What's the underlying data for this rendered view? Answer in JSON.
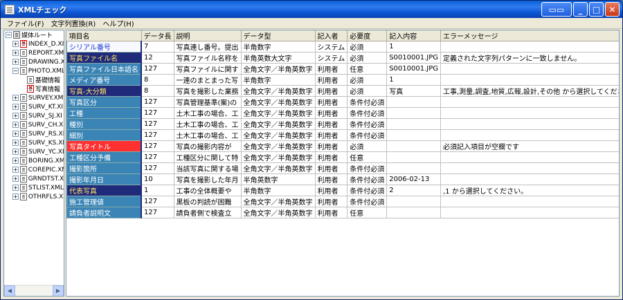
{
  "window": {
    "title": "XMLチェック"
  },
  "menu": [
    "ファイル(F)",
    "文字列置換(R)",
    "ヘルプ(H)"
  ],
  "tree": [
    {
      "label": "媒体ルート",
      "level": 0,
      "expander": "−",
      "icon": "root"
    },
    {
      "label": "INDEX_D.XI",
      "level": 1,
      "expander": "+",
      "icon": "error"
    },
    {
      "label": "REPORT.XM",
      "level": 1,
      "expander": "+",
      "icon": "doc"
    },
    {
      "label": "DRAWING.X",
      "level": 1,
      "expander": "+",
      "icon": "doc"
    },
    {
      "label": "PHOTO.XML",
      "level": 1,
      "expander": "−",
      "icon": "doc"
    },
    {
      "label": "基礎情報",
      "level": 2,
      "expander": "",
      "icon": "doc"
    },
    {
      "label": "写真情報",
      "level": 2,
      "expander": "",
      "icon": "error"
    },
    {
      "label": "SURVEY.XM",
      "level": 1,
      "expander": "+",
      "icon": "doc"
    },
    {
      "label": "SURV_KT.XI",
      "level": 1,
      "expander": "+",
      "icon": "doc"
    },
    {
      "label": "SURV_SJ.XI",
      "level": 1,
      "expander": "+",
      "icon": "doc"
    },
    {
      "label": "SURV_CH.XI",
      "level": 1,
      "expander": "+",
      "icon": "doc"
    },
    {
      "label": "SURV_RS.XI",
      "level": 1,
      "expander": "+",
      "icon": "doc"
    },
    {
      "label": "SURV_KS.XI",
      "level": 1,
      "expander": "+",
      "icon": "doc"
    },
    {
      "label": "SURV_YC.XI",
      "level": 1,
      "expander": "+",
      "icon": "doc"
    },
    {
      "label": "BORING.XM",
      "level": 1,
      "expander": "+",
      "icon": "doc"
    },
    {
      "label": "COREPIC.XM",
      "level": 1,
      "expander": "+",
      "icon": "doc"
    },
    {
      "label": "GRNDTST.XI",
      "level": 1,
      "expander": "+",
      "icon": "doc"
    },
    {
      "label": "STLIST.XML",
      "level": 1,
      "expander": "+",
      "icon": "doc"
    },
    {
      "label": "OTHRFLS.XI",
      "level": 1,
      "expander": "+",
      "icon": "doc"
    }
  ],
  "grid": {
    "headers": [
      "項目名",
      "データ長",
      "説明",
      "データ型",
      "記入者",
      "必要度",
      "記入内容",
      "エラーメッセージ"
    ],
    "rows": [
      {
        "style": "light",
        "cells": [
          "シリアル番号",
          "7",
          "写真連し番号。提出",
          "半角数字",
          "システム",
          "必須",
          "1",
          ""
        ]
      },
      {
        "style": "sel",
        "cells": [
          "写真ファイル名",
          "12",
          "写真ファイル名称を",
          "半角英数大文字",
          "システム",
          "必須",
          "S0010001.JPG",
          "定義された文字列パターンに一致しません。"
        ]
      },
      {
        "style": "normal",
        "cells": [
          "写真ファイル日本語名",
          "127",
          "写真ファイルに関す",
          "全角文字／半角英数字",
          "利用者",
          "任意",
          "S0010001.JPG",
          ""
        ]
      },
      {
        "style": "normal",
        "cells": [
          "メディア番号",
          "8",
          "一連のまとまった写",
          "半角数字",
          "利用者",
          "必須",
          "1",
          ""
        ]
      },
      {
        "style": "warn",
        "cells": [
          "写真-大分類",
          "8",
          "写真を撮影した業務",
          "全角文字／半角英数字",
          "利用者",
          "必須",
          "写真",
          "工事,測量,調査,地質,広報,設計,その他 から選択してください。"
        ]
      },
      {
        "style": "normal",
        "cells": [
          "写真区分",
          "127",
          "写真管理基準(案)の",
          "全角文字／半角英数字",
          "利用者",
          "条件付必須",
          "",
          ""
        ]
      },
      {
        "style": "normal",
        "cells": [
          "工種",
          "127",
          "土木工事の場合、工",
          "全角文字／半角英数字",
          "利用者",
          "条件付必須",
          "",
          ""
        ]
      },
      {
        "style": "normal",
        "cells": [
          "種別",
          "127",
          "土木工事の場合、工",
          "全角文字／半角英数字",
          "利用者",
          "条件付必須",
          "",
          ""
        ]
      },
      {
        "style": "normal",
        "cells": [
          "細別",
          "127",
          "土木工事の場合、工",
          "全角文字／半角英数字",
          "利用者",
          "条件付必須",
          "",
          ""
        ]
      },
      {
        "style": "err",
        "cells": [
          "写真タイトル",
          "127",
          "写真の撮影内容が",
          "全角文字／半角英数字",
          "利用者",
          "必須",
          "",
          "必須記入項目が空欄です"
        ]
      },
      {
        "style": "normal",
        "cells": [
          "工種区分予備",
          "127",
          "工種区分に関して特",
          "全角文字／半角英数字",
          "利用者",
          "任意",
          "",
          ""
        ]
      },
      {
        "style": "normal",
        "cells": [
          "撮影箇所",
          "127",
          "当該写真に関する場",
          "全角文字／半角英数字",
          "利用者",
          "条件付必須",
          "",
          ""
        ]
      },
      {
        "style": "normal",
        "cells": [
          "撮影年月日",
          "10",
          "写真を撮影した年月",
          "半角英数字",
          "利用者",
          "条件付必須",
          "2006-02-13",
          ""
        ]
      },
      {
        "style": "warn",
        "cells": [
          "代表写真",
          "1",
          "工事の全体概要や",
          "半角数字",
          "利用者",
          "条件付必須",
          "2",
          ",1 から選択してください。"
        ]
      },
      {
        "style": "normal",
        "cells": [
          "施工管理値",
          "127",
          "黒板の判読が困難",
          "全角文字／半角英数字",
          "利用者",
          "条件付必須",
          "",
          ""
        ]
      },
      {
        "style": "normal",
        "cells": [
          "請負者説明文",
          "127",
          "請負者側で検査立",
          "全角文字／半角英数字",
          "利用者",
          "任意",
          "",
          ""
        ]
      }
    ]
  }
}
